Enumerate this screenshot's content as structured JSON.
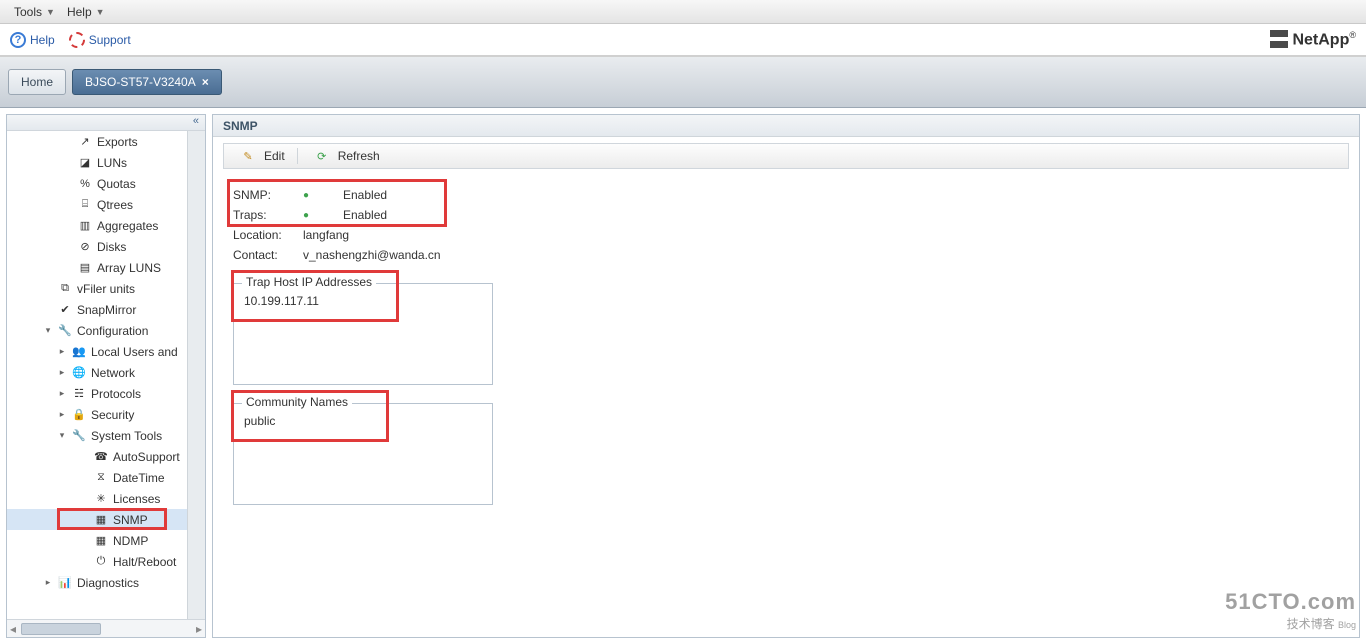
{
  "menubar": {
    "tools": "Tools",
    "help": "Help"
  },
  "supportbar": {
    "help": "Help",
    "support": "Support",
    "brand_bold": "NetApp",
    "brand_sup": "®"
  },
  "tabs": {
    "home": "Home",
    "active": "BJSO-ST57-V3240A"
  },
  "nav_collapse_glyph": "«",
  "tree": [
    {
      "indent": 56,
      "icon": "exports-icon",
      "label": "Exports"
    },
    {
      "indent": 56,
      "icon": "luns-icon",
      "label": "LUNs"
    },
    {
      "indent": 56,
      "icon": "quotas-icon",
      "label": "Quotas"
    },
    {
      "indent": 56,
      "icon": "qtrees-icon",
      "label": "Qtrees"
    },
    {
      "indent": 56,
      "icon": "aggregates-icon",
      "label": "Aggregates"
    },
    {
      "indent": 56,
      "icon": "disks-icon",
      "label": "Disks"
    },
    {
      "indent": 56,
      "icon": "arrayluns-icon",
      "label": "Array LUNS"
    },
    {
      "indent": 36,
      "icon": "vfiler-icon",
      "label": "vFiler units"
    },
    {
      "indent": 36,
      "icon": "snapmirror-icon",
      "label": "SnapMirror"
    },
    {
      "indent": 36,
      "icon": "config-icon",
      "label": "Configuration",
      "expander": "▾"
    },
    {
      "indent": 50,
      "icon": "users-icon",
      "label": "Local Users and",
      "expander": "▸"
    },
    {
      "indent": 50,
      "icon": "network-icon",
      "label": "Network",
      "expander": "▸"
    },
    {
      "indent": 50,
      "icon": "protocols-icon",
      "label": "Protocols",
      "expander": "▸"
    },
    {
      "indent": 50,
      "icon": "security-icon",
      "label": "Security",
      "expander": "▸"
    },
    {
      "indent": 50,
      "icon": "systools-icon",
      "label": "System Tools",
      "expander": "▾"
    },
    {
      "indent": 72,
      "icon": "autosupport-icon",
      "label": "AutoSupport"
    },
    {
      "indent": 72,
      "icon": "datetime-icon",
      "label": "DateTime"
    },
    {
      "indent": 72,
      "icon": "licenses-icon",
      "label": "Licenses"
    },
    {
      "indent": 72,
      "icon": "snmp-icon",
      "label": "SNMP",
      "selected": true,
      "hl": true
    },
    {
      "indent": 72,
      "icon": "ndmp-icon",
      "label": "NDMP"
    },
    {
      "indent": 72,
      "icon": "halt-icon",
      "label": "Halt/Reboot"
    },
    {
      "indent": 36,
      "icon": "diag-icon",
      "label": "Diagnostics",
      "expander": "▸"
    }
  ],
  "content": {
    "title": "SNMP",
    "toolbar": {
      "edit": "Edit",
      "refresh": "Refresh"
    },
    "kv": {
      "snmp_k": "SNMP:",
      "snmp_v": "Enabled",
      "traps_k": "Traps:",
      "traps_v": "Enabled",
      "loc_k": "Location:",
      "loc_v": "langfang",
      "contact_k": "Contact:",
      "contact_v": "v_nashengzhi@wanda.cn"
    },
    "trap_legend": "Trap Host IP Addresses",
    "trap_value": "10.199.117.11",
    "comm_legend": "Community Names",
    "comm_value": "public"
  },
  "watermark": {
    "l1": "51CTO.com",
    "l2": "技术博客",
    "l2b": "Blog"
  }
}
